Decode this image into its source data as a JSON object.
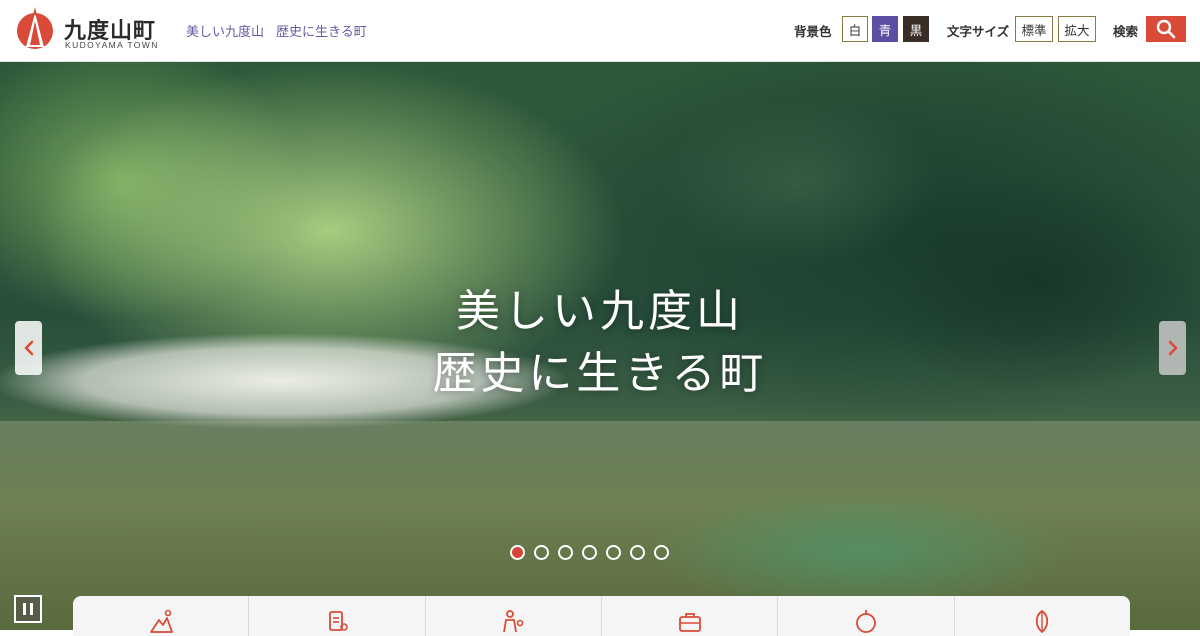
{
  "header": {
    "logo_name": "九度山町",
    "logo_en": "KUDOYAMA TOWN",
    "tagline": [
      "美しい九度山",
      "歴史に生きる町"
    ],
    "bg_color_label": "背景色",
    "bg_options": [
      "白",
      "青",
      "黒"
    ],
    "font_size_label": "文字サイズ",
    "font_options": [
      "標準",
      "拡大"
    ],
    "search_label": "検索",
    "search_icon": "search-icon"
  },
  "hero": {
    "title_lines": [
      "美しい九度山",
      "歴史に生きる町"
    ],
    "prev_icon": "chevron-left-icon",
    "next_icon": "chevron-right-icon",
    "slide_count": 7,
    "active_slide": 1,
    "pause_icon": "pause-icon"
  },
  "category_nav": {
    "icons": [
      "landscape-icon",
      "document-person-icon",
      "family-icon",
      "briefcase-icon",
      "sightseeing-icon",
      "history-icon"
    ]
  },
  "colors": {
    "accent": "#d94a38",
    "tagline": "#6a5aa6",
    "bg_blue": "#5b4fa3",
    "bg_black": "#3a2d25"
  }
}
